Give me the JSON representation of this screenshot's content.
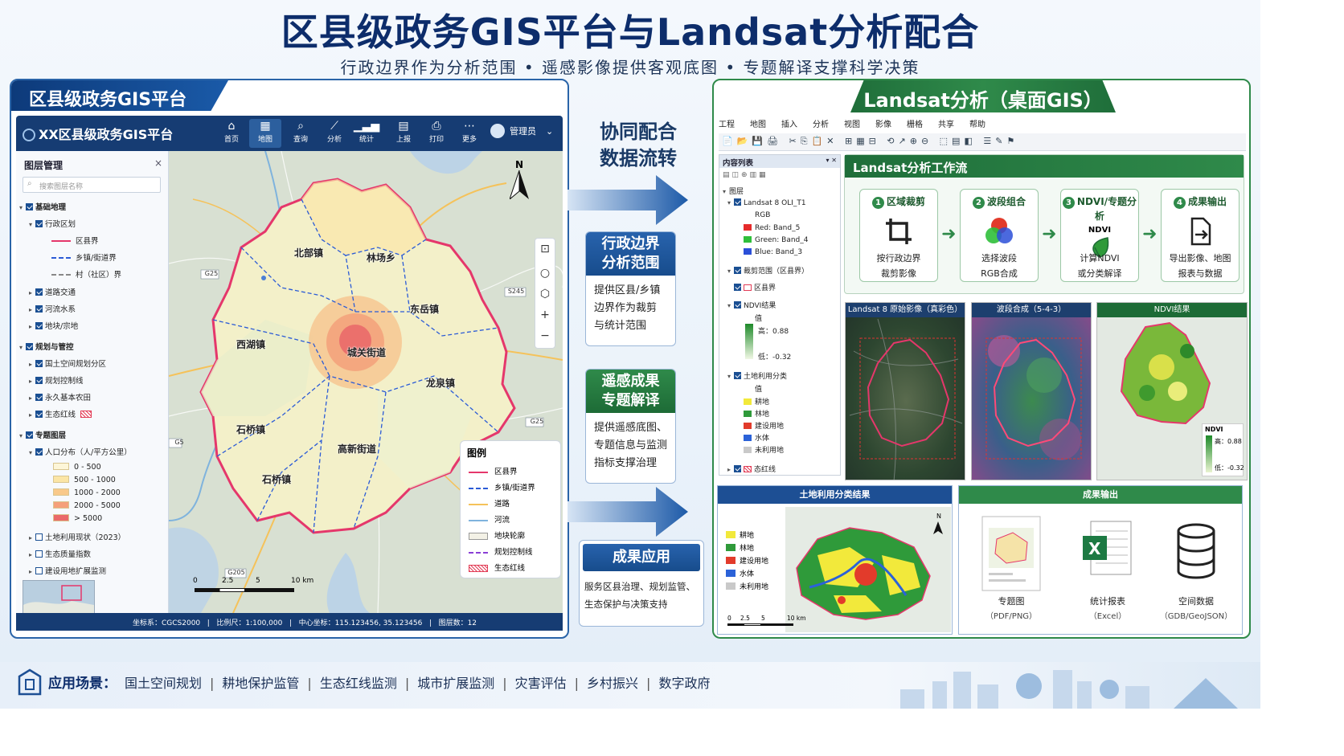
{
  "header": {
    "title": "区县级政务GIS平台与Landsat分析配合",
    "subtitle": "行政边界作为分析范围  •  遥感影像提供客观底图  •  专题解译支撑科学决策"
  },
  "left_panel": {
    "heading": "区县级政务GIS平台",
    "app": {
      "name": "XX区县级政务GIS平台",
      "nav": [
        {
          "label": "首页",
          "icon": "home-icon"
        },
        {
          "label": "地图",
          "icon": "map-icon",
          "active": true
        },
        {
          "label": "查询",
          "icon": "search-icon"
        },
        {
          "label": "分析",
          "icon": "analysis-icon"
        },
        {
          "label": "统计",
          "icon": "stats-icon"
        },
        {
          "label": "上报",
          "icon": "report-icon"
        },
        {
          "label": "打印",
          "icon": "print-icon"
        },
        {
          "label": "更多",
          "icon": "more-icon"
        }
      ],
      "user": "管理员"
    },
    "layer_panel": {
      "title": "图层管理",
      "close": "×",
      "search_placeholder": "搜索图层名称",
      "g1": "基础地理",
      "g1a": "行政区划",
      "g1a1": "区县界",
      "g1a2": "乡镇/街道界",
      "g1a3": "村（社区）界",
      "g1b": "道路交通",
      "g1c": "河流水系",
      "g1d": "地块/宗地",
      "g2": "规划与管控",
      "g2a": "国土空间规划分区",
      "g2b": "规划控制线",
      "g2c": "永久基本农田",
      "g2d": "生态红线",
      "g3": "专题图层",
      "g3a": "人口分布（人/平方公里）",
      "pop": [
        "0 - 500",
        "500 - 1000",
        "1000 - 2000",
        "2000 - 5000",
        "> 5000"
      ],
      "pop_colors": [
        "#fdf6d8",
        "#fbe5a5",
        "#f9c98a",
        "#f5a07a",
        "#ea6a6a"
      ],
      "g4": "土地利用现状（2023）",
      "g5": "生态质量指数",
      "g6": "建设用地扩展监测"
    },
    "map": {
      "places": [
        "北部镇",
        "林场乡",
        "东岳镇",
        "西湖镇",
        "城关街道",
        "龙泉镇",
        "石桥镇",
        "高新街道",
        "石桥镇"
      ],
      "roads": [
        "G25",
        "S245",
        "G5",
        "G25",
        "G205"
      ],
      "north": "N",
      "scale": [
        "0",
        "2.5",
        "5",
        "10 km"
      ],
      "legend": {
        "title": "图例",
        "items": [
          "区县界",
          "乡镇/街道界",
          "道路",
          "河流",
          "地块轮廓",
          "规划控制线",
          "生态红线"
        ]
      }
    },
    "status": {
      "crs": "坐标系：CGCS2000",
      "scale": "比例尺：1:100,000",
      "center": "中心坐标：115.123456, 35.123456",
      "layers": "图层数：12"
    }
  },
  "middle": {
    "flow": [
      "协同配合",
      "数据流转"
    ],
    "card1": {
      "title": [
        "行政边界",
        "分析范围"
      ],
      "body": [
        "提供区县/乡镇",
        "边界作为裁剪",
        "与统计范围"
      ]
    },
    "card2": {
      "title": [
        "遥感成果",
        "专题解译"
      ],
      "body": [
        "提供遥感底图、",
        "专题信息与监测",
        "指标支撑治理"
      ]
    },
    "card3": {
      "title": "成果应用",
      "body": [
        "服务区县治理、规划监管、",
        "生态保护与决策支持"
      ]
    }
  },
  "right_panel": {
    "heading": "Landsat分析（桌面GIS）",
    "menus": [
      "工程",
      "地图",
      "插入",
      "分析",
      "视图",
      "影像",
      "栅格",
      "共享",
      "帮助"
    ],
    "toc": {
      "title": "内容列表",
      "layers": "图层",
      "l1": "Landsat 8 OLI_T1",
      "rgb": "RGB",
      "red": "Red:   Band_5",
      "green": "Green: Band_4",
      "blue": "Blue:  Band_3",
      "l2": "裁剪范围（区县界）",
      "l2a": "区县界",
      "l3": "NDVI结果",
      "val": "值",
      "hi": "高：0.88",
      "lo": "低：-0.32",
      "l4": "土地利用分类",
      "val2": "值",
      "classes": [
        "耕地",
        "林地",
        "建设用地",
        "水体",
        "未利用地"
      ],
      "class_colors": [
        "#f2e93b",
        "#2f9a3a",
        "#e23b2b",
        "#2b62d8",
        "#c9c9c9"
      ],
      "l5": "态红线"
    },
    "workflow": {
      "title": "Landsat分析工作流",
      "steps": [
        {
          "n": "1",
          "title": "区域裁剪",
          "d1": "按行政边界",
          "d2": "裁剪影像",
          "icon": "crop-icon"
        },
        {
          "n": "2",
          "title": "波段组合",
          "d1": "选择波段",
          "d2": "RGB合成",
          "icon": "rgb-icon"
        },
        {
          "n": "3",
          "title": "NDVI/专题分析",
          "sub": "NDVI",
          "d1": "计算NDVI",
          "d2": "或分类解译",
          "icon": "leaf-icon"
        },
        {
          "n": "4",
          "title": "成果输出",
          "d1": "导出影像、地图",
          "d2": "报表与数据",
          "icon": "export-icon"
        }
      ]
    },
    "images": [
      {
        "title": "Landsat 8 原始影像（真彩色）"
      },
      {
        "title": "波段合成（5-4-3）"
      },
      {
        "title": "NDVI结果",
        "legend_title": "NDVI",
        "hi": "高：0.88",
        "lo": "低：-0.32"
      }
    ],
    "landuse": {
      "title": "土地利用分类结果",
      "classes": [
        "耕地",
        "林地",
        "建设用地",
        "水体",
        "未利用地"
      ],
      "north": "N",
      "scale": [
        "0",
        "2.5",
        "5",
        "10 km"
      ]
    },
    "output": {
      "title": "成果输出",
      "items": [
        {
          "label": "专题图",
          "sub": "（PDF/PNG）",
          "icon": "thematic-map-icon"
        },
        {
          "label": "统计报表",
          "sub": "（Excel）",
          "icon": "excel-icon"
        },
        {
          "label": "空间数据",
          "sub": "（GDB/GeoJSON）",
          "icon": "database-icon"
        }
      ]
    }
  },
  "footer": {
    "label": "应用场景：",
    "items": [
      "国土空间规划",
      "耕地保护监管",
      "生态红线监测",
      "城市扩展监测",
      "灾害评估",
      "乡村振兴",
      "数字政府"
    ]
  },
  "colors": {
    "navy": "#0d2d6b",
    "blue": "#1d4f94",
    "green": "#2f8a4a",
    "boundary": "#e5376b"
  }
}
